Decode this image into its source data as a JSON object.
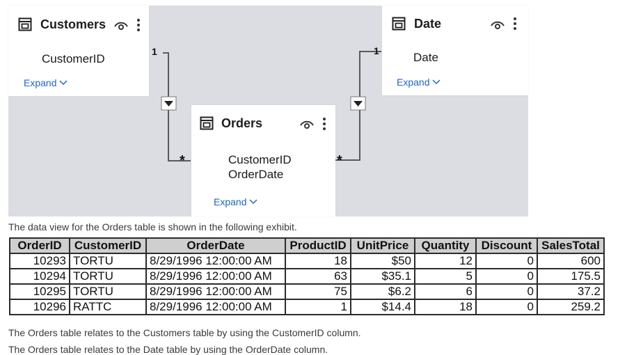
{
  "model": {
    "tables": [
      {
        "id": "customers",
        "name": "Customers",
        "fields": [
          "CustomerID"
        ],
        "expand_label": "Expand"
      },
      {
        "id": "date",
        "name": "Date",
        "fields": [
          "Date"
        ],
        "expand_label": "Expand"
      },
      {
        "id": "orders",
        "name": "Orders",
        "fields": [
          "CustomerID",
          "OrderDate"
        ],
        "expand_label": "Expand"
      }
    ],
    "relationships": [
      {
        "from": "Customers",
        "to": "Orders",
        "one_label": "1",
        "many_label": "*"
      },
      {
        "from": "Date",
        "to": "Orders",
        "one_label": "1",
        "many_label": "*"
      }
    ]
  },
  "captions": {
    "data_view_intro": "The data view for the Orders table is shown in the following exhibit.",
    "relation_customers": "The Orders table relates to the Customers table by using the CustomerID column.",
    "relation_date": "The Orders table relates to the Date table by using the OrderDate column."
  },
  "orders_table": {
    "columns": [
      "OrderID",
      "CustomerID",
      "OrderDate",
      "ProductID",
      "UnitPrice",
      "Quantity",
      "Discount",
      "SalesTotal"
    ],
    "rows": [
      [
        "10293",
        "TORTU",
        "8/29/1996 12:00:00 AM",
        "18",
        "$50",
        "12",
        "0",
        "600"
      ],
      [
        "10294",
        "TORTU",
        "8/29/1996 12:00:00 AM",
        "63",
        "$35.1",
        "5",
        "0",
        "175.5"
      ],
      [
        "10295",
        "TORTU",
        "8/29/1996 12:00:00 AM",
        "75",
        "$6.2",
        "6",
        "0",
        "37.2"
      ],
      [
        "10296",
        "RATTC",
        "8/29/1996 12:00:00 AM",
        "1",
        "$14.4",
        "18",
        "0",
        "259.2"
      ]
    ]
  },
  "colors": {
    "canvas": "#dcdde2",
    "link": "#1f66c9",
    "header_bg": "#cfcfcf",
    "line": "#5a5a5a"
  }
}
